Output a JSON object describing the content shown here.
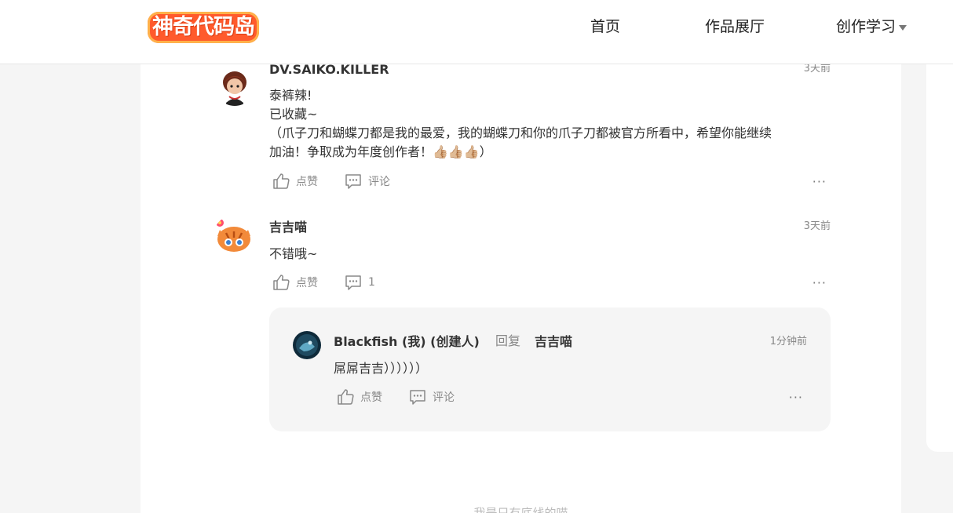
{
  "header": {
    "logo_text": "神奇代码岛",
    "nav": {
      "home": "首页",
      "gallery": "作品展厅",
      "learn": "创作学习"
    }
  },
  "comments": [
    {
      "username": "DV.SAIKO.KILLER",
      "time": "3天前",
      "text": "泰裤辣!\n已收藏~\n（爪子刀和蝴蝶刀都是我的最爱，我的蝴蝶刀和你的爪子刀都被官方所看中，希望你能继续\n加油！争取成为年度创作者！👍🏼👍🏼👍🏼）",
      "like_label": "点赞",
      "comment_label": "评论"
    },
    {
      "username": "吉吉喵",
      "time": "3天前",
      "text": "不错哦~",
      "like_label": "点赞",
      "comment_count": "1",
      "reply": {
        "username": "Blackfish (我) (创建人)",
        "reply_word": "回复",
        "target": "吉吉喵",
        "time": "1分钟前",
        "text": "屌屌吉吉））））））",
        "like_label": "点赞",
        "comment_label": "评论"
      }
    }
  ],
  "footer_note": "我是只有底线的喵",
  "more_label": "···",
  "colors": {
    "brand": "#ff5a2c",
    "muted": "#888888"
  }
}
